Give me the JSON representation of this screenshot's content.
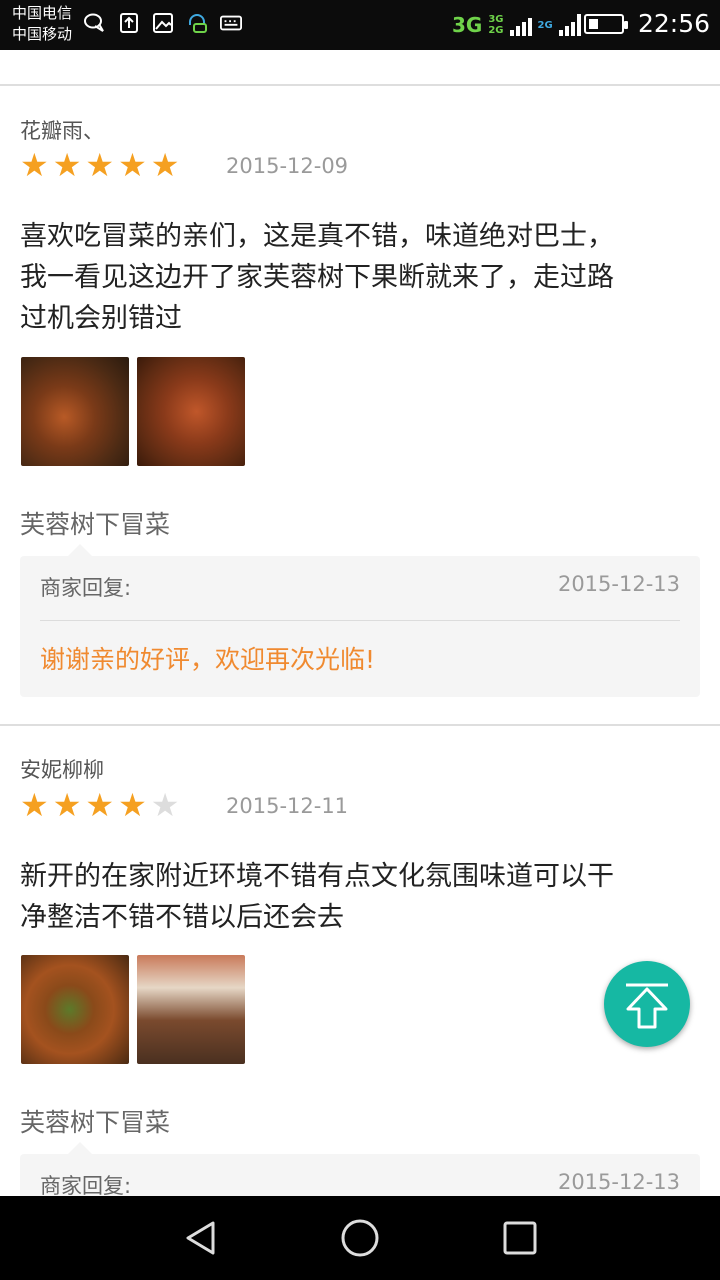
{
  "status_bar": {
    "carrier_1": "中国电信",
    "carrier_2": "中国移动",
    "net_main": "3G",
    "net_small_top": "3G",
    "net_small_bottom": "2G",
    "net_secondary": "2G",
    "time": "22:56",
    "battery_level": 0.3
  },
  "reviews": [
    {
      "user": "花瓣雨、",
      "rating": 5,
      "date": "2015-12-09",
      "text_lines": [
        "喜欢吃冒菜的亲们，这是真不错，味道绝对巴士，",
        "我一看见这边开了家芙蓉树下果断就来了，走过路",
        "过机会别错过"
      ],
      "shop_name": "芙蓉树下冒菜",
      "reply_label": "商家回复:",
      "reply_date": "2015-12-13",
      "reply_text": "谢谢亲的好评，欢迎再次光临!"
    },
    {
      "user": "安妮柳柳",
      "rating": 4,
      "date": "2015-12-11",
      "text_lines": [
        "新开的在家附近环境不错有点文化氛围味道可以干",
        "净整洁不错不错以后还会去"
      ],
      "shop_name": "芙蓉树下冒菜",
      "reply_label": "商家回复:",
      "reply_date": "2015-12-13"
    }
  ],
  "colors": {
    "star_on": "#f5a021",
    "star_off": "#dddddd",
    "reply_text": "#f08a30",
    "fab": "#16b8a3"
  },
  "icons": {
    "fab": "arrow-up-icon",
    "nav": [
      "back-triangle-icon",
      "home-circle-icon",
      "recents-square-icon"
    ]
  }
}
